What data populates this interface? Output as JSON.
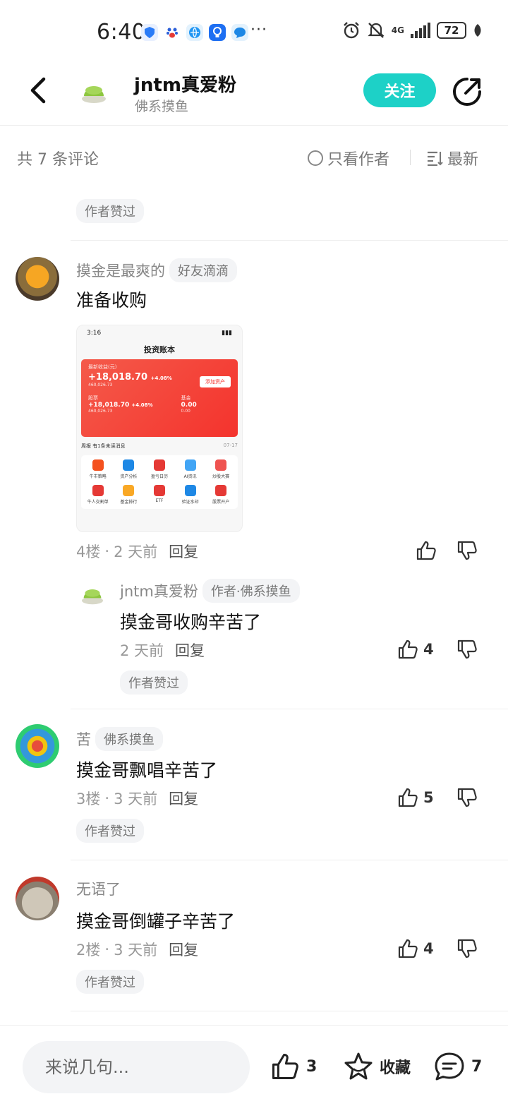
{
  "status_bar": {
    "time": "6:40",
    "dots": "···",
    "network": "4G",
    "battery": "72"
  },
  "nav": {
    "name": "jntm真爱粉",
    "subtitle": "佛系摸鱼",
    "follow_label": "关注"
  },
  "comments_header": {
    "count": "共 7 条评论",
    "author_only": "只看作者",
    "sort": "最新"
  },
  "top_tag": "作者赞过",
  "comments": [
    {
      "user": "摸金是最爽的",
      "badge": "好友滴滴",
      "text": "准备收购",
      "floor": "4楼",
      "time": "2 天前",
      "reply_label": "回复",
      "likes": ""
    },
    {
      "user": "jntm真爱粉",
      "badge": "作者·佛系摸鱼",
      "text": "摸金哥收购辛苦了",
      "floor": "",
      "time": "2 天前",
      "reply_label": "回复",
      "likes": "4",
      "tag": "作者赞过"
    },
    {
      "user": "苦",
      "badge": "佛系摸鱼",
      "text": "摸金哥飘唱辛苦了",
      "floor": "3楼",
      "time": "3 天前",
      "reply_label": "回复",
      "likes": "5",
      "tag": "作者赞过"
    },
    {
      "user": "无语了",
      "badge": "",
      "text": "摸金哥倒罐子辛苦了",
      "floor": "2楼",
      "time": "3 天前",
      "reply_label": "回复",
      "likes": "4",
      "tag": "作者赞过"
    }
  ],
  "screenshot": {
    "time": "3:16",
    "title": "投资账本",
    "label1": "最新收益(元)",
    "value1": "+18,018.70",
    "pct1": "+4.08%",
    "sub1": "460,026.73",
    "add_btn": "添加资产",
    "stock_label": "股票",
    "stock_value": "+18,018.70",
    "stock_pct": "+4.08%",
    "stock_sub": "460,026.73",
    "fund_label": "基金",
    "fund_value": "0.00",
    "fund_sub": "0.00",
    "news": "周报  有1条未读消息",
    "news_date": "07-17",
    "grid": [
      "牛市策略",
      "资产分析",
      "盈亏日历",
      "AI资讯",
      "炒股大赛",
      "牛人交割单",
      "基金排行",
      "ETF",
      "验证水印",
      "股票开户"
    ]
  },
  "bottom_bar": {
    "placeholder": "来说几句...",
    "likes": "3",
    "favorite_label": "收藏",
    "comments": "7"
  },
  "colors": {
    "accent": "#1dd1c7",
    "red": "#f4332d"
  }
}
